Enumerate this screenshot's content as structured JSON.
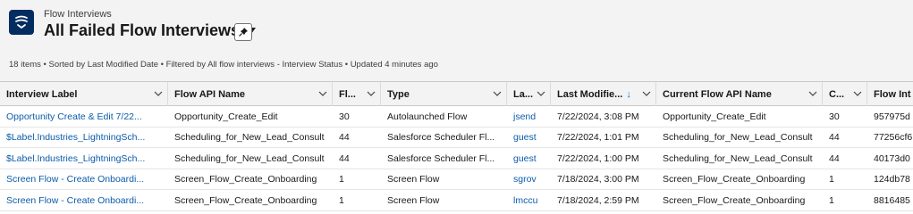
{
  "header": {
    "object_label": "Flow Interviews",
    "list_title": "All Failed Flow Interviews",
    "status_line": "18 items • Sorted by Last Modified Date • Filtered by All flow interviews - Interview Status • Updated 4 minutes ago"
  },
  "icons": {
    "app": "flow-icon",
    "pin": "pin-icon",
    "column_menu": "chevron-down-icon",
    "sort": "arrow-down-icon"
  },
  "colors": {
    "app_icon_bg": "#032d60",
    "link": "#0b5cab",
    "header_bg": "#f3f3f3"
  },
  "table": {
    "columns": [
      "Interview Label",
      "Flow API Name",
      "Fl...",
      "Type",
      "La...",
      "Last Modifie...",
      "Current Flow API Name",
      "C...",
      "Flow Int"
    ],
    "sort_arrow": "↓",
    "rows": [
      [
        "Opportunity Create & Edit 7/22...",
        "Opportunity_Create_Edit",
        "30",
        "Autolaunched Flow",
        "jsend",
        "7/22/2024, 3:08 PM",
        "Opportunity_Create_Edit",
        "30",
        "957975d"
      ],
      [
        "$Label.Industries_LightningSch...",
        "Scheduling_for_New_Lead_Consult",
        "44",
        "Salesforce Scheduler Fl...",
        "guest",
        "7/22/2024, 1:01 PM",
        "Scheduling_for_New_Lead_Consult",
        "44",
        "77256cf6"
      ],
      [
        "$Label.Industries_LightningSch...",
        "Scheduling_for_New_Lead_Consult",
        "44",
        "Salesforce Scheduler Fl...",
        "guest",
        "7/22/2024, 1:00 PM",
        "Scheduling_for_New_Lead_Consult",
        "44",
        "40173d0"
      ],
      [
        "Screen Flow - Create Onboardi...",
        "Screen_Flow_Create_Onboarding",
        "1",
        "Screen Flow",
        "sgrov",
        "7/18/2024, 3:00 PM",
        "Screen_Flow_Create_Onboarding",
        "1",
        "124db78"
      ],
      [
        "Screen Flow - Create Onboardi...",
        "Screen_Flow_Create_Onboarding",
        "1",
        "Screen Flow",
        "lmccu",
        "7/18/2024, 2:59 PM",
        "Screen_Flow_Create_Onboarding",
        "1",
        "8816485"
      ]
    ]
  }
}
